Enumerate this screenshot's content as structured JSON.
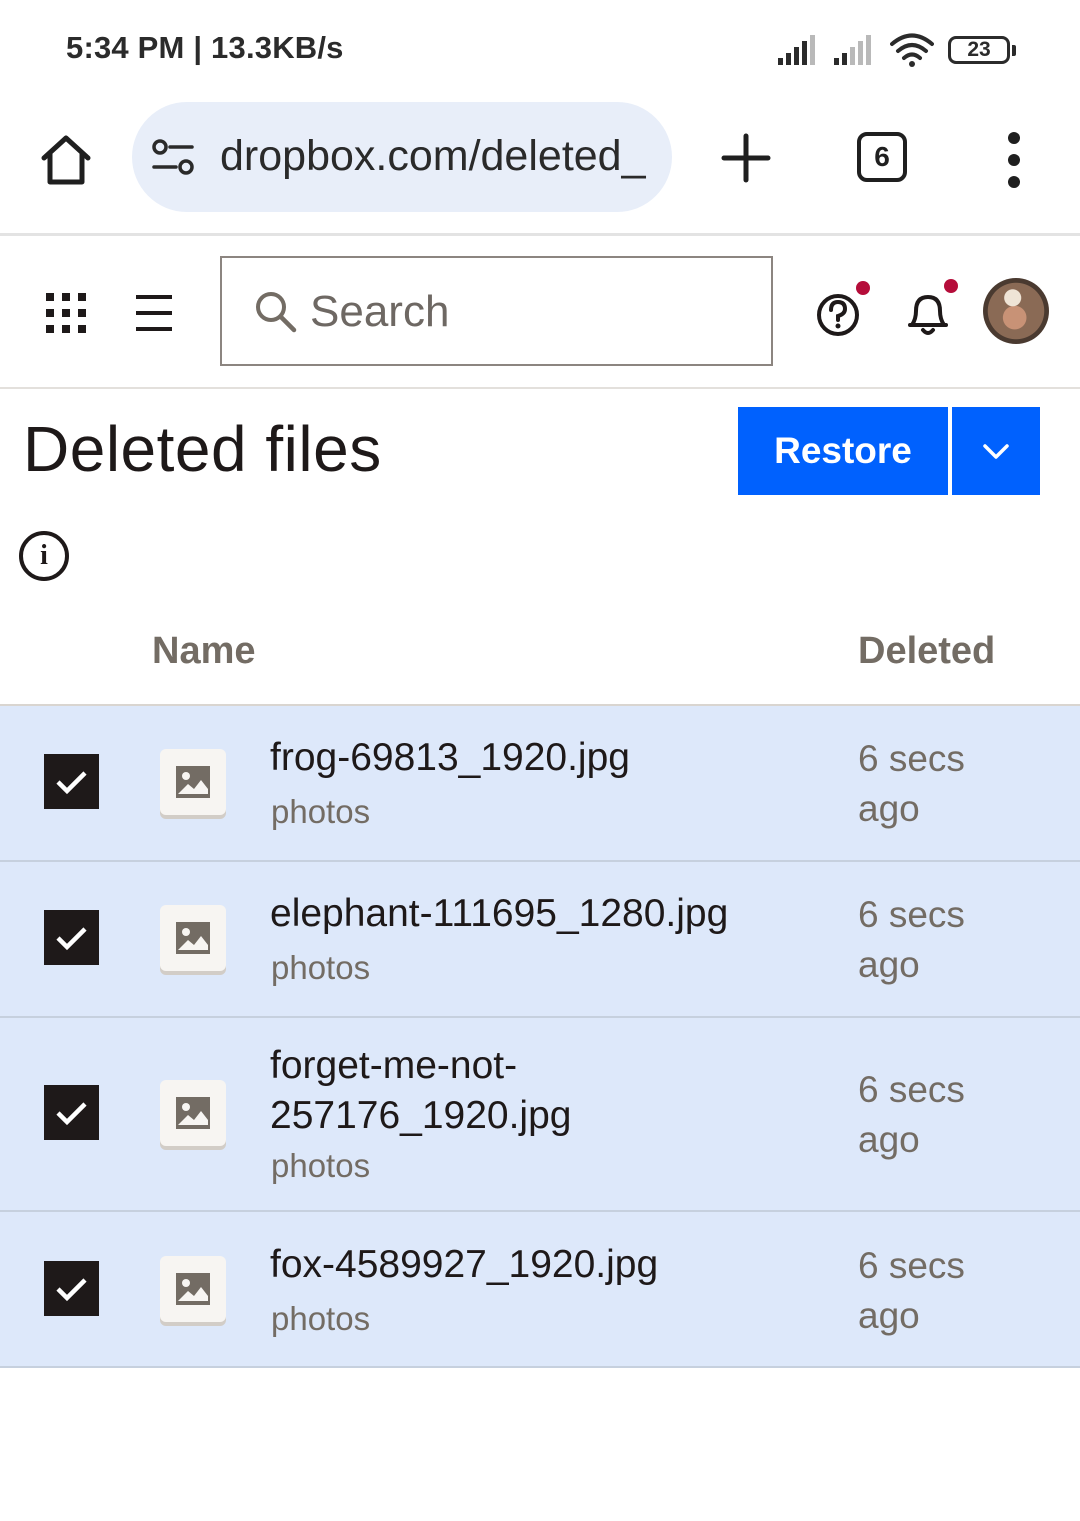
{
  "status_bar": {
    "time": "5:34 PM | 13.3KB/s",
    "battery": "23"
  },
  "browser": {
    "url": "dropbox.com/deleted_",
    "tab_count": "6"
  },
  "topbar": {
    "search_placeholder": "Search"
  },
  "page": {
    "title": "Deleted files",
    "restore_label": "Restore"
  },
  "table": {
    "col_name": "Name",
    "col_deleted": "Deleted",
    "rows": [
      {
        "name": "frog-69813_1920.jpg",
        "path": "photos",
        "deleted": "6 secs ago",
        "checked": true
      },
      {
        "name": "elephant-111695_1280.jpg",
        "path": "photos",
        "deleted": "6 secs ago",
        "checked": true
      },
      {
        "name": "forget-me-not-257176_1920.jpg",
        "path": "photos",
        "deleted": "6 secs ago",
        "checked": true
      },
      {
        "name": "fox-4589927_1920.jpg",
        "path": "photos",
        "deleted": "6 secs ago",
        "checked": true
      }
    ]
  },
  "colors": {
    "accent": "#0061fe",
    "selected_row": "#dde8fa",
    "notification_dot": "#b50d3a"
  }
}
